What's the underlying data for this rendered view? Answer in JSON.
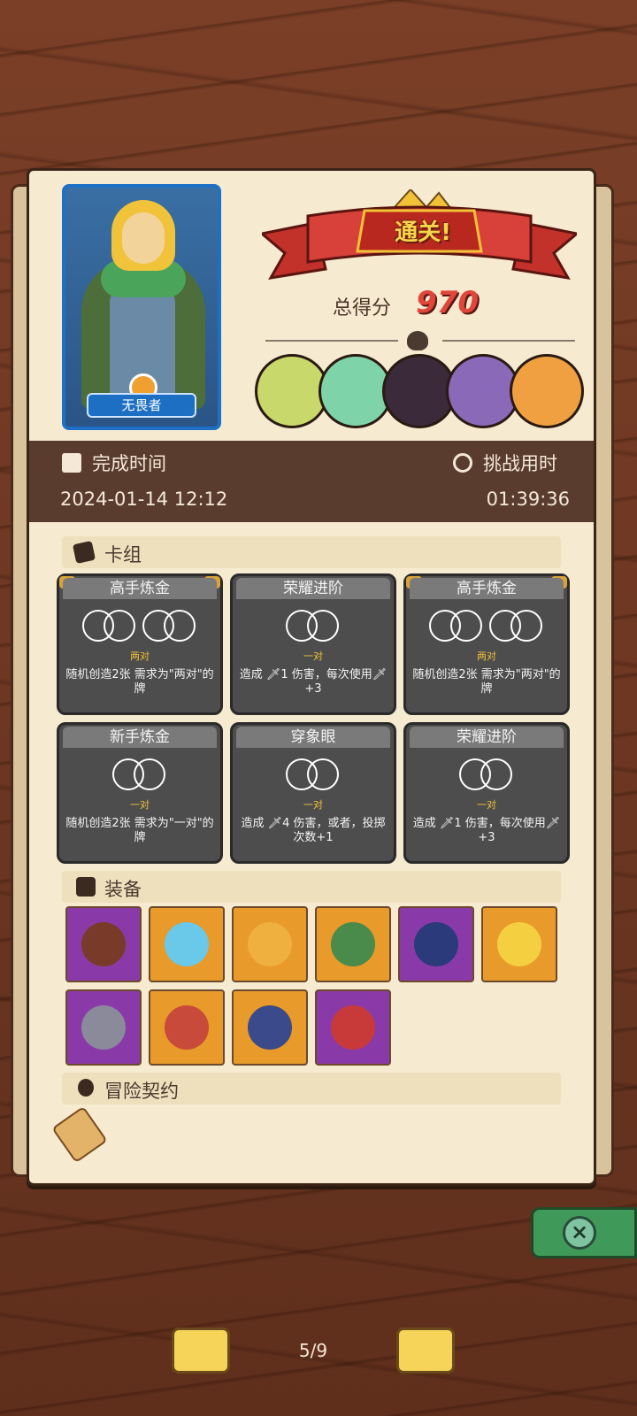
{
  "hero": {
    "name": "无畏者"
  },
  "result": {
    "banner": "通关!",
    "score_label": "总得分",
    "score_value": "970"
  },
  "stats": {
    "finish_label": "完成时间",
    "finish_value": "2024-01-14 12:12",
    "duration_label": "挑战用时",
    "duration_value": "01:39:36"
  },
  "sections": {
    "deck": "卡组",
    "equipment": "装备",
    "contracts": "冒险契约"
  },
  "cards": [
    {
      "title": "高手炼金",
      "requirement": "两对",
      "desc": "随机创造2张 需求为\"两对\"的牌",
      "gold": true,
      "pairs": 2
    },
    {
      "title": "荣耀进阶",
      "requirement": "一对",
      "desc": "造成 🗡1 伤害，每次使用🗡+3",
      "gold": false,
      "pairs": 1
    },
    {
      "title": "高手炼金",
      "requirement": "两对",
      "desc": "随机创造2张 需求为\"两对\"的牌",
      "gold": true,
      "pairs": 2
    },
    {
      "title": "新手炼金",
      "requirement": "一对",
      "desc": "随机创造2张 需求为\"一对\"的牌",
      "gold": false,
      "pairs": 1
    },
    {
      "title": "穿象眼",
      "requirement": "一对",
      "desc": "造成 🗡4 伤害，或者，投掷次数+1",
      "gold": false,
      "pairs": 1
    },
    {
      "title": "荣耀进阶",
      "requirement": "一对",
      "desc": "造成 🗡1 伤害，每次使用🗡+3",
      "gold": false,
      "pairs": 1
    }
  ],
  "enemies": [
    {
      "name": "skeleton-enemy",
      "color": "#c8d86a"
    },
    {
      "name": "lizard-enemy",
      "color": "#7ed4a8"
    },
    {
      "name": "dark-knight-enemy",
      "color": "#3a2a3a"
    },
    {
      "name": "dragon-enemy",
      "color": "#8a6ab8"
    },
    {
      "name": "crystal-golem-enemy",
      "color": "#f0a040"
    }
  ],
  "equipment": [
    {
      "name": "button-shield-item",
      "bg": "#8a3aa8",
      "art": "#7a3a2a"
    },
    {
      "name": "crystal-shield-item",
      "bg": "#e89a2a",
      "art": "#6ac8e8"
    },
    {
      "name": "sweater-item",
      "bg": "#e89a2a",
      "art": "#f0b040"
    },
    {
      "name": "turtle-shell-item",
      "bg": "#e89a2a",
      "art": "#4a8a4a"
    },
    {
      "name": "horn-helmet-item",
      "bg": "#8a3aa8",
      "art": "#2a3a7a"
    },
    {
      "name": "crown-item",
      "bg": "#e89a2a",
      "art": "#f4d040"
    },
    {
      "name": "metal-cube-item",
      "bg": "#8a3aa8",
      "art": "#8a8a9a"
    },
    {
      "name": "meat-leg-item",
      "bg": "#e89a2a",
      "art": "#c84a3a"
    },
    {
      "name": "hexagram-item",
      "bg": "#e89a2a",
      "art": "#3a4a8a"
    },
    {
      "name": "bracelet-item",
      "bg": "#8a3aa8",
      "art": "#c83a3a"
    }
  ],
  "pager": "5/9"
}
